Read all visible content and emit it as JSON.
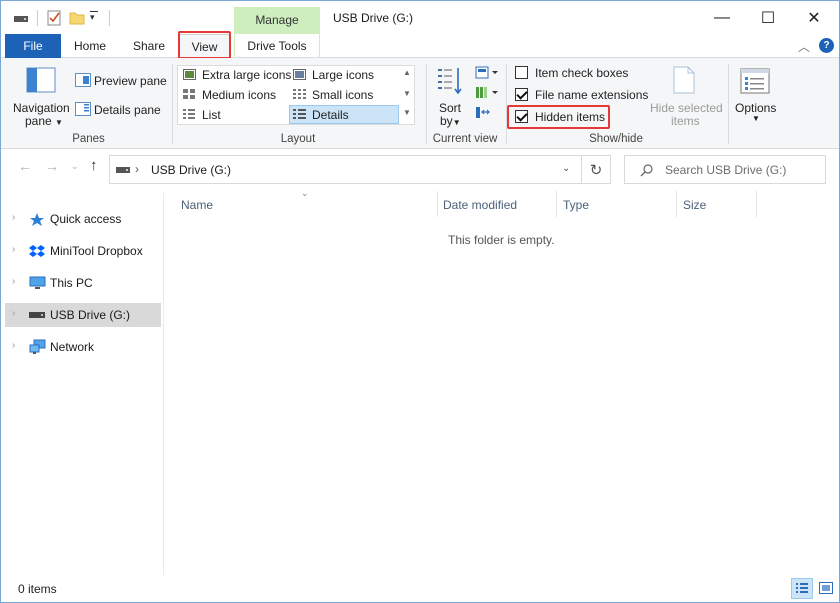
{
  "window": {
    "title": "USB Drive (G:)",
    "controls": {
      "minimize": "—",
      "maximize": "☐",
      "close": "✕"
    }
  },
  "ribbon_tabs": {
    "context_label": "Manage",
    "file": "File",
    "home": "Home",
    "share": "Share",
    "view": "View",
    "drive_tools": "Drive Tools"
  },
  "panes": {
    "navigation_pane_l1": "Navigation",
    "navigation_pane_l2": "pane",
    "preview_pane": "Preview pane",
    "details_pane": "Details pane",
    "label": "Panes"
  },
  "layout": {
    "extra_large_icons": "Extra large icons",
    "large_icons": "Large icons",
    "medium_icons": "Medium icons",
    "small_icons": "Small icons",
    "list": "List",
    "details": "Details",
    "label": "Layout"
  },
  "current_view": {
    "sort_l1": "Sort",
    "sort_l2": "by",
    "label": "Current view"
  },
  "show_hide": {
    "item_check_boxes": "Item check boxes",
    "file_name_extensions": "File name extensions",
    "hidden_items": "Hidden items",
    "hide_selected_l1": "Hide selected",
    "hide_selected_l2": "items",
    "label": "Show/hide",
    "checked": {
      "item_check_boxes": false,
      "file_name_extensions": true,
      "hidden_items": true
    }
  },
  "options": {
    "label": "Options"
  },
  "address": {
    "path": "USB Drive (G:)",
    "search_placeholder": "Search USB Drive (G:)"
  },
  "nav_pane": {
    "items": [
      {
        "label": "Quick access",
        "icon": "star-icon"
      },
      {
        "label": "MiniTool Dropbox",
        "icon": "dropbox-icon"
      },
      {
        "label": "This PC",
        "icon": "monitor-icon"
      },
      {
        "label": "USB Drive (G:)",
        "icon": "drive-icon"
      },
      {
        "label": "Network",
        "icon": "network-icon"
      }
    ]
  },
  "columns": {
    "name": "Name",
    "date_modified": "Date modified",
    "type": "Type",
    "size": "Size"
  },
  "content": {
    "empty_message": "This folder is empty."
  },
  "status": {
    "item_count": "0 items"
  },
  "colors": {
    "accent": "#1c62b6",
    "manage_tab": "#cfeec0",
    "highlight": "#e53935",
    "selection": "#cce4f7"
  }
}
